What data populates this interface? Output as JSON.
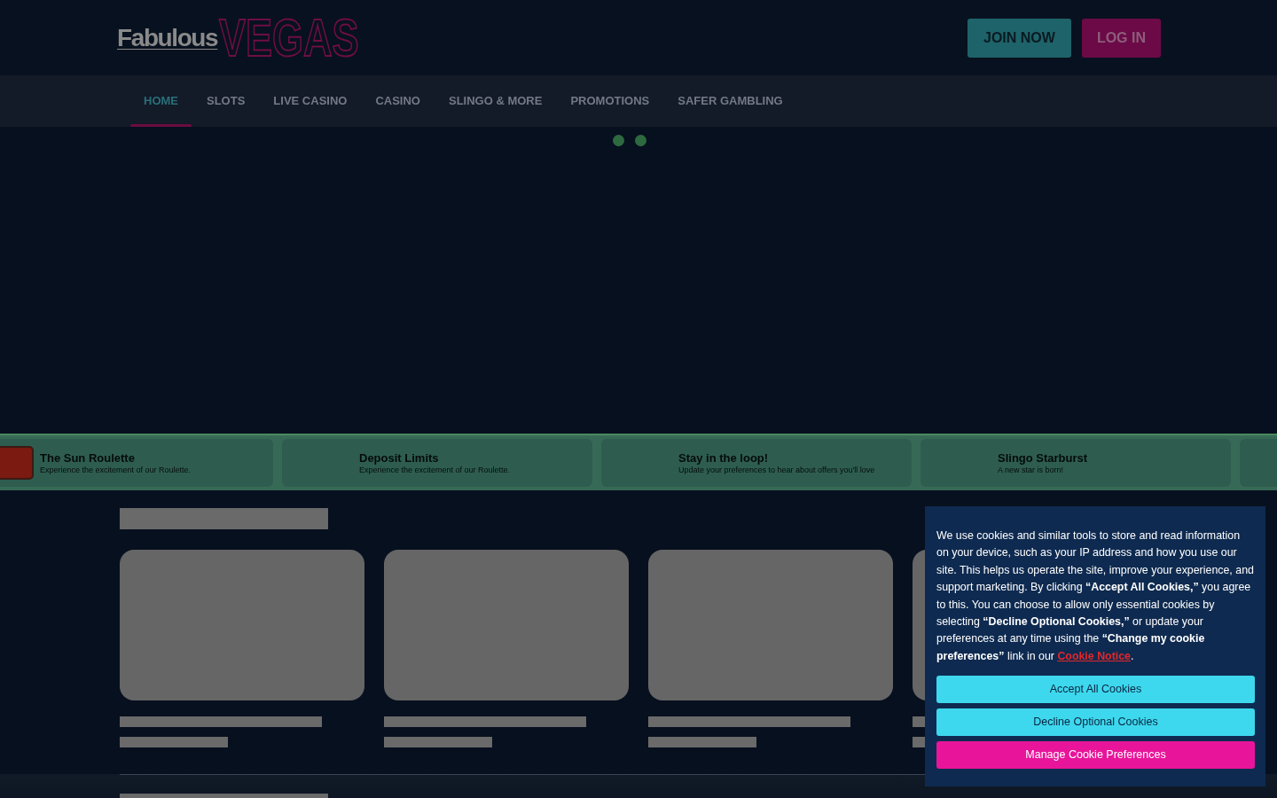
{
  "header": {
    "logo": {
      "prefix": "Fabulous",
      "highlight": "VEGAS"
    },
    "buttons": [
      {
        "label": "JOIN NOW",
        "kind": "join"
      },
      {
        "label": "LOG IN",
        "kind": "login"
      }
    ]
  },
  "nav": {
    "items": [
      {
        "label": "HOME",
        "selected": true
      },
      {
        "label": "SLOTS",
        "selected": false
      },
      {
        "label": "LIVE CASINO",
        "selected": false
      },
      {
        "label": "CASINO",
        "selected": false
      },
      {
        "label": "SLINGO & MORE",
        "selected": false
      },
      {
        "label": "PROMOTIONS",
        "selected": false
      },
      {
        "label": "SAFER GAMBLING",
        "selected": false
      }
    ]
  },
  "carousel": {
    "dots": [
      {
        "selected": false
      },
      {
        "selected": false
      }
    ]
  },
  "promo_strip": {
    "cards": [
      {
        "title": "The Sun Roulette",
        "subtitle": "Experience the excitement of our Roulette.",
        "thumbnail": true
      },
      {
        "title": "Deposit Limits",
        "subtitle": "Experience the excitement of our Roulette.",
        "thumbnail": false
      },
      {
        "title": "Stay in the loop!",
        "subtitle": "Update your preferences to hear about offers you'll love",
        "thumbnail": false
      },
      {
        "title": "Slingo Starburst",
        "subtitle": "A new star is born!",
        "thumbnail": false
      },
      {
        "thumbnail": false
      }
    ]
  },
  "game_sections": [
    {
      "kind": "skeleton",
      "cards": [
        {
          "kind": "skeleton"
        },
        {
          "kind": "skeleton"
        },
        {
          "kind": "skeleton"
        },
        {
          "kind": "skeleton"
        }
      ]
    },
    {
      "kind": "skeleton"
    }
  ],
  "cookie_banner": {
    "text": "We use cookies and similar tools to store and read information on your device, such as your IP address and how you use our site. This helps us operate the site, improve your experience, and support marketing. By clicking **“Accept All Cookies,”** you agree to this. You can choose to allow only essential cookies by selecting **“Decline Optional Cookies,”** or update your preferences at any time using the **“Change my cookie preferences”** link in our",
    "link": "Cookie Notice",
    "text_after": ".",
    "buttons": [
      {
        "label": "Accept All Cookies",
        "kind": "primary"
      },
      {
        "label": "Decline Optional Cookies",
        "kind": "primary"
      },
      {
        "label": "Manage Cookie Preferences",
        "kind": "accent"
      }
    ]
  }
}
